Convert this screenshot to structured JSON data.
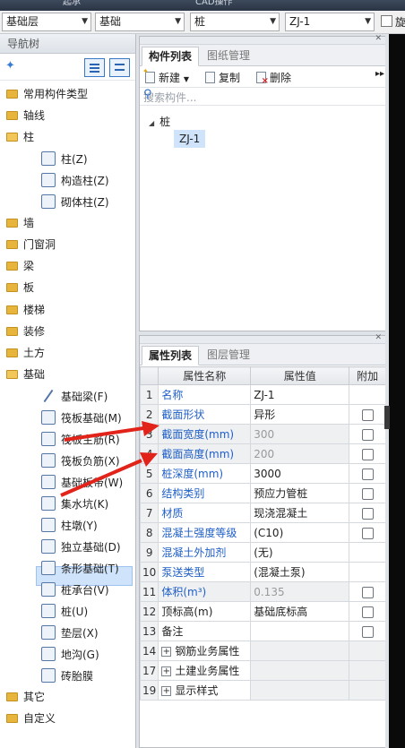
{
  "top_strip": {
    "left_text": "起承",
    "center_text": "CAD操作"
  },
  "combos": [
    {
      "value": "基础层"
    },
    {
      "value": "基础"
    },
    {
      "value": "桩"
    },
    {
      "value": "ZJ-1"
    }
  ],
  "top_right_label": "旋",
  "nav": {
    "header": "导航树",
    "items": [
      {
        "label": "常用构件类型",
        "type": "folder"
      },
      {
        "label": "轴线",
        "type": "folder"
      },
      {
        "label": "柱",
        "type": "folder-open"
      },
      {
        "label": "柱(Z)",
        "type": "sub"
      },
      {
        "label": "构造柱(Z)",
        "type": "sub"
      },
      {
        "label": "砌体柱(Z)",
        "type": "sub"
      },
      {
        "label": "墙",
        "type": "folder"
      },
      {
        "label": "门窗洞",
        "type": "folder"
      },
      {
        "label": "梁",
        "type": "folder"
      },
      {
        "label": "板",
        "type": "folder"
      },
      {
        "label": "楼梯",
        "type": "folder"
      },
      {
        "label": "装修",
        "type": "folder"
      },
      {
        "label": "土方",
        "type": "folder"
      },
      {
        "label": "基础",
        "type": "folder-open"
      },
      {
        "label": "基础梁(F)",
        "type": "sub"
      },
      {
        "label": "筏板基础(M)",
        "type": "sub"
      },
      {
        "label": "筏板主筋(R)",
        "type": "sub"
      },
      {
        "label": "筏板负筋(X)",
        "type": "sub"
      },
      {
        "label": "基础板带(W)",
        "type": "sub"
      },
      {
        "label": "集水坑(K)",
        "type": "sub"
      },
      {
        "label": "柱墩(Y)",
        "type": "sub"
      },
      {
        "label": "独立基础(D)",
        "type": "sub"
      },
      {
        "label": "条形基础(T)",
        "type": "sub"
      },
      {
        "label": "桩承台(V)",
        "type": "sub"
      },
      {
        "label": "桩(U)",
        "type": "sub"
      },
      {
        "label": "垫层(X)",
        "type": "sub"
      },
      {
        "label": "地沟(G)",
        "type": "sub"
      },
      {
        "label": "砖胎膜",
        "type": "sub"
      },
      {
        "label": "其它",
        "type": "folder"
      },
      {
        "label": "自定义",
        "type": "folder"
      }
    ]
  },
  "component_panel": {
    "tabs": [
      "构件列表",
      "图纸管理"
    ],
    "toolbar": {
      "new": "新建",
      "copy": "复制",
      "delete": "删除"
    },
    "search_placeholder": "搜索构件...",
    "tree_root": "桩",
    "tree_child": "ZJ-1"
  },
  "property_panel": {
    "tabs": [
      "属性列表",
      "图层管理"
    ],
    "columns": [
      "属性名称",
      "属性值",
      "附加"
    ],
    "rows": [
      {
        "num": "1",
        "name": "名称",
        "value": "ZJ-1",
        "blue": true,
        "gray": false,
        "check": "none"
      },
      {
        "num": "2",
        "name": "截面形状",
        "value": "异形",
        "blue": true,
        "gray": false,
        "check": "box"
      },
      {
        "num": "3",
        "name": "截面宽度(mm)",
        "value": "300",
        "blue": true,
        "gray": true,
        "check": "box"
      },
      {
        "num": "4",
        "name": "截面高度(mm)",
        "value": "200",
        "blue": true,
        "gray": true,
        "check": "box"
      },
      {
        "num": "5",
        "name": "桩深度(mm)",
        "value": "3000",
        "blue": true,
        "gray": false,
        "check": "box"
      },
      {
        "num": "6",
        "name": "结构类别",
        "value": "预应力管桩",
        "blue": true,
        "gray": false,
        "check": "box"
      },
      {
        "num": "7",
        "name": "材质",
        "value": "现浇混凝土",
        "blue": true,
        "gray": false,
        "check": "box"
      },
      {
        "num": "8",
        "name": "混凝土强度等级",
        "value": "(C10)",
        "blue": true,
        "gray": false,
        "check": "box"
      },
      {
        "num": "9",
        "name": "混凝土外加剂",
        "value": "(无)",
        "blue": true,
        "gray": false,
        "check": "none"
      },
      {
        "num": "10",
        "name": "泵送类型",
        "value": "(混凝土泵)",
        "blue": true,
        "gray": false,
        "check": "none"
      },
      {
        "num": "11",
        "name": "体积(m³)",
        "value": "0.135",
        "blue": true,
        "gray": true,
        "check": "box"
      },
      {
        "num": "12",
        "name": "顶标高(m)",
        "value": "基础底标高",
        "blue": false,
        "gray": false,
        "check": "box"
      },
      {
        "num": "13",
        "name": "备注",
        "value": "",
        "blue": false,
        "gray": false,
        "check": "box"
      }
    ],
    "groups": [
      {
        "num": "14",
        "name": "钢筋业务属性"
      },
      {
        "num": "17",
        "name": "土建业务属性"
      },
      {
        "num": "19",
        "name": "显示样式"
      }
    ]
  },
  "colors": {
    "link_blue": "#1f5fc7",
    "selection": "#cfe3fb",
    "arrow_red": "#e2231a"
  }
}
